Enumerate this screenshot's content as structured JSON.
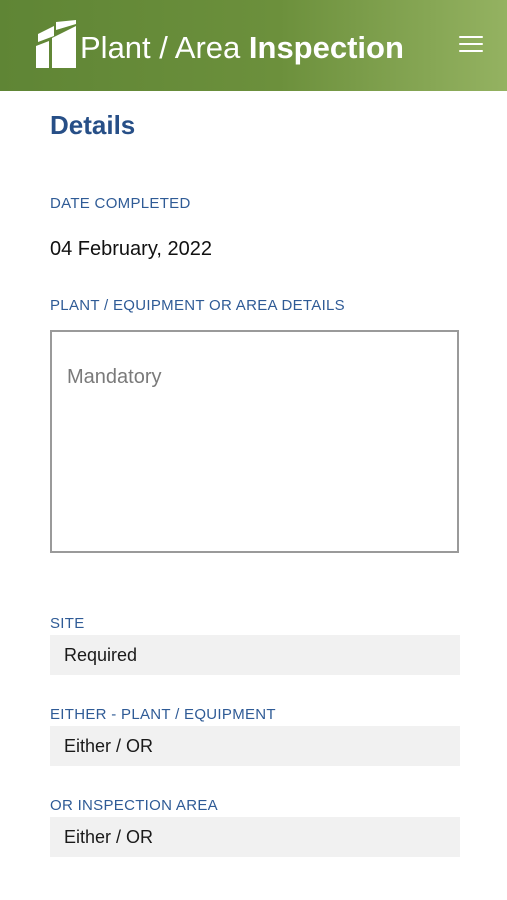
{
  "header": {
    "title_light": "Plant / Area ",
    "title_bold": "Inspection",
    "logo_icon": "ti-logo-icon",
    "menu_icon": "hamburger-menu-icon",
    "colors": {
      "gradient_start": "#5f8535",
      "gradient_end": "#94b261"
    }
  },
  "details": {
    "section_title": "Details",
    "date_completed": {
      "label": "DATE COMPLETED",
      "value": "04 February, 2022"
    },
    "plant_details": {
      "label": "PLANT / EQUIPMENT OR AREA DETAILS",
      "placeholder": "Mandatory"
    },
    "site": {
      "label": "SITE",
      "value": "Required"
    },
    "plant_equipment": {
      "label": "EITHER - PLANT / EQUIPMENT",
      "value": "Either / OR"
    },
    "inspection_area": {
      "label": "OR INSPECTION AREA",
      "value": "Either / OR"
    }
  },
  "colors": {
    "label": "#2f5b96",
    "section_title": "#274f87",
    "field_bg": "#f1f1f1"
  }
}
